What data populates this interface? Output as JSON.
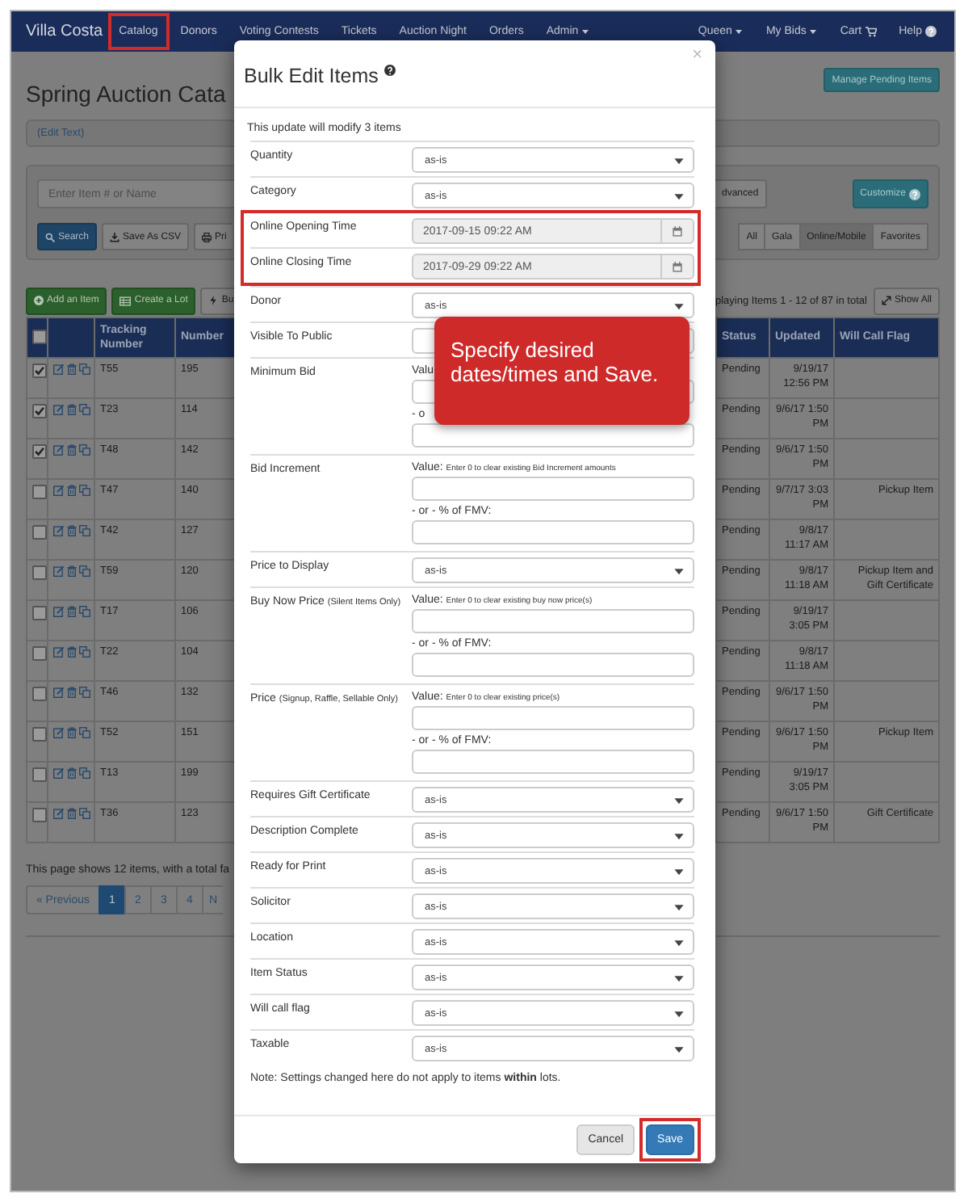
{
  "nav": {
    "brand": "Villa Costa",
    "items": [
      {
        "label": "Catalog",
        "kind": "link",
        "highlighted": true
      },
      {
        "label": "Donors",
        "kind": "link",
        "highlighted": false
      },
      {
        "label": "Voting Contests",
        "kind": "link",
        "highlighted": false
      },
      {
        "label": "Tickets",
        "kind": "link",
        "highlighted": false
      },
      {
        "label": "Auction Night",
        "kind": "link",
        "highlighted": false
      },
      {
        "label": "Orders",
        "kind": "link",
        "highlighted": false
      },
      {
        "label": "Admin",
        "kind": "dropdown",
        "highlighted": false
      }
    ],
    "right_items": [
      {
        "label": "Queen",
        "kind": "dropdown"
      },
      {
        "label": "My Bids",
        "kind": "dropdown"
      },
      {
        "label": "Cart",
        "kind": "cart"
      },
      {
        "label": "Help",
        "kind": "help"
      }
    ]
  },
  "page": {
    "title": "Spring Auction Cata",
    "manage_button": "Manage Pending Items",
    "edit_text": "(Edit Text)"
  },
  "search": {
    "placeholder": "Enter Item # or Name",
    "advanced_button": "dvanced",
    "customize_button": "Customize",
    "buttons": [
      {
        "label": "Search",
        "kind": "search"
      },
      {
        "label": "Save As CSV",
        "kind": "csv"
      },
      {
        "label": "Pri",
        "kind": "print"
      }
    ],
    "filters": [
      {
        "label": "All",
        "selected": false
      },
      {
        "label": "Gala",
        "selected": false
      },
      {
        "label": "Online/Mobile",
        "selected": true
      },
      {
        "label": "Favorites",
        "selected": false
      }
    ]
  },
  "actions": {
    "buttons": [
      {
        "label": "Add an Item",
        "kind": "add"
      },
      {
        "label": "Create a Lot",
        "kind": "lot"
      },
      {
        "label": "Bu",
        "kind": "bulk"
      }
    ],
    "summary": "playing Items 1 - 12 of 87 in total",
    "show_all": "Show All"
  },
  "table": {
    "header_checked": false,
    "left_columns": [
      "Tracking Number",
      "Number"
    ],
    "right_columns": [
      "Status",
      "Updated",
      "Will Call Flag"
    ],
    "rows": [
      {
        "checked": true,
        "tracking": "T55",
        "number": "195",
        "status": "Pending",
        "updated": "9/19/17 12:56 PM"
      },
      {
        "checked": true,
        "tracking": "T23",
        "number": "114",
        "status": "Pending",
        "updated": "9/6/17 1:50 PM"
      },
      {
        "checked": true,
        "tracking": "T48",
        "number": "142",
        "status": "Pending",
        "updated": "9/6/17 1:50 PM"
      },
      {
        "checked": false,
        "tracking": "T47",
        "number": "140",
        "status": "Pending",
        "updated": "9/7/17 3:03 PM",
        "will_call": "Pickup Item"
      },
      {
        "checked": false,
        "tracking": "T42",
        "number": "127",
        "status": "Pending",
        "updated": "9/8/17 11:17 AM"
      },
      {
        "checked": false,
        "tracking": "T59",
        "number": "120",
        "status": "Pending",
        "updated": "9/8/17 11:18 AM",
        "will_call": "Pickup Item and Gift Certificate"
      },
      {
        "checked": false,
        "tracking": "T17",
        "number": "106",
        "status": "Pending",
        "updated": "9/19/17 3:05 PM"
      },
      {
        "checked": false,
        "tracking": "T22",
        "number": "104",
        "status": "Pending",
        "updated": "9/8/17 11:18 AM"
      },
      {
        "checked": false,
        "tracking": "T46",
        "number": "132",
        "status": "Pending",
        "updated": "9/6/17 1:50 PM"
      },
      {
        "checked": false,
        "tracking": "T52",
        "number": "151",
        "status": "Pending",
        "updated": "9/6/17 1:50 PM",
        "will_call": "Pickup Item"
      },
      {
        "checked": false,
        "tracking": "T13",
        "number": "199",
        "status": "Pending",
        "updated": "9/19/17 3:05 PM"
      },
      {
        "checked": false,
        "tracking": "T36",
        "number": "123",
        "status": "Pending",
        "updated": "9/6/17 1:50 PM",
        "will_call": "Gift Certificate"
      }
    ]
  },
  "footer": {
    "summary": "This page shows 12 items, with a total fa",
    "pages": [
      {
        "label": "« Previous",
        "selected": false
      },
      {
        "label": "1",
        "selected": true
      },
      {
        "label": "2",
        "selected": false
      },
      {
        "label": "3",
        "selected": false
      },
      {
        "label": "4",
        "selected": false
      },
      {
        "label": "N",
        "selected": false
      }
    ]
  },
  "modal": {
    "title": "Bulk Edit Items",
    "close": "×",
    "intro": "This update will modify 3 items",
    "fields": [
      {
        "kind": "select",
        "label": "Quantity",
        "value": "as-is"
      },
      {
        "kind": "select",
        "label": "Category",
        "value": "as-is"
      },
      {
        "kind": "group",
        "highlighted": true,
        "fields": [
          {
            "kind": "date",
            "label": "Online Opening Time",
            "value": "2017-09-15 09:22 AM"
          },
          {
            "kind": "date",
            "label": "Online Closing Time",
            "value": "2017-09-29 09:22 AM"
          }
        ]
      },
      {
        "kind": "select",
        "label": "Donor",
        "value": "as-is"
      },
      {
        "kind": "select",
        "label": "Visible To Public"
      },
      {
        "kind": "amount",
        "label": "Minimum Bid",
        "value_label": "Valu",
        "or_label": "- o"
      },
      {
        "kind": "amount",
        "label": "Bid Increment",
        "value_label": "Value:",
        "hint": "Enter 0 to clear existing Bid Increment amounts",
        "or_label": "- or - % of FMV:"
      },
      {
        "kind": "select",
        "label": "Price to Display",
        "value": "as-is"
      },
      {
        "kind": "amount",
        "label": "Buy Now Price",
        "note": "(Silent Items Only)",
        "value_label": "Value:",
        "hint": "Enter 0 to clear existing buy now price(s)",
        "or_label": "- or - % of FMV:"
      },
      {
        "kind": "amount",
        "label": "Price",
        "note": "(Signup, Raffle, Sellable Only)",
        "value_label": "Value:",
        "hint": "Enter 0 to clear existing price(s)",
        "or_label": "- or - % of FMV:"
      },
      {
        "kind": "select",
        "label": "Requires Gift Certificate",
        "value": "as-is"
      },
      {
        "kind": "select",
        "label": "Description Complete",
        "value": "as-is"
      },
      {
        "kind": "select",
        "label": "Ready for Print",
        "value": "as-is"
      },
      {
        "kind": "select",
        "label": "Solicitor",
        "value": "as-is"
      },
      {
        "kind": "select",
        "label": "Location",
        "value": "as-is"
      },
      {
        "kind": "select",
        "label": "Item Status",
        "value": "as-is"
      },
      {
        "kind": "select",
        "label": "Will call flag",
        "value": "as-is"
      },
      {
        "kind": "select",
        "label": "Taxable",
        "value": "as-is"
      }
    ],
    "note": "Note: Settings changed here do not apply to items **within** lots.",
    "buttons": [
      {
        "label": "Cancel",
        "kind": "default",
        "highlighted": false
      },
      {
        "label": "Save",
        "kind": "primary",
        "highlighted": true
      }
    ]
  },
  "callout": {
    "text": "Specify desired dates/times and Save."
  }
}
